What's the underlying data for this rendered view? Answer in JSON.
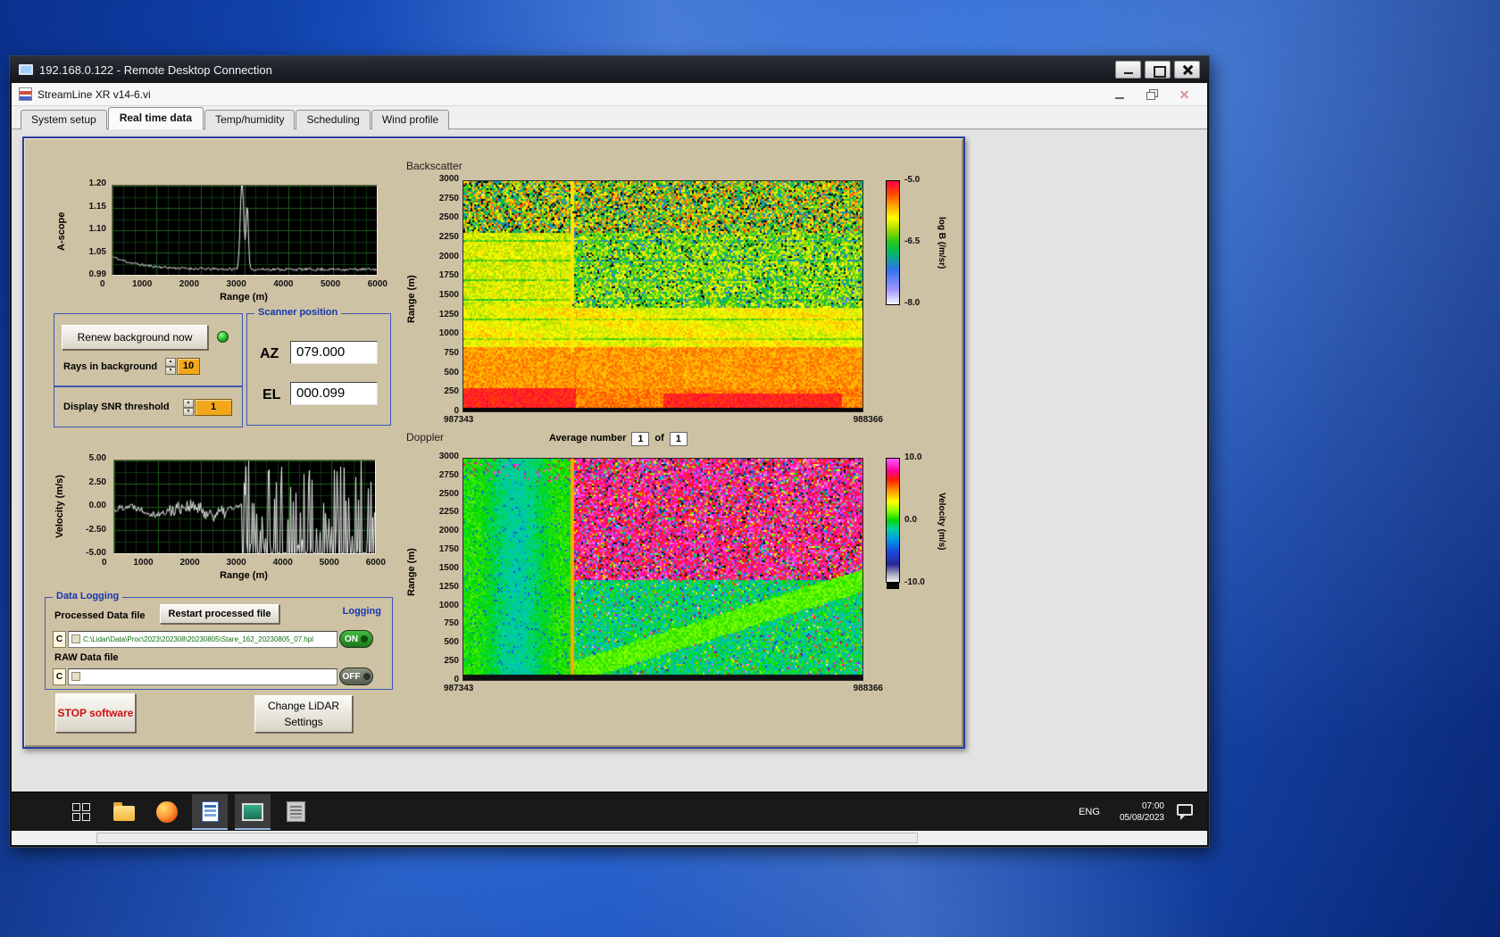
{
  "rdp": {
    "title": "192.168.0.122 - Remote Desktop Connection"
  },
  "app": {
    "title": "StreamLine XR v14-6.vi",
    "tabs": [
      "System setup",
      "Real time data",
      "Temp/humidity",
      "Scheduling",
      "Wind profile"
    ]
  },
  "ascope": {
    "ylabel": "A-scope",
    "xlabel": "Range (m)",
    "yticks": [
      "1.20",
      "1.15",
      "1.10",
      "1.05",
      "0.99"
    ],
    "xticks": [
      "0",
      "1000",
      "2000",
      "3000",
      "4000",
      "5000",
      "6000"
    ]
  },
  "controls": {
    "renew": "Renew background now",
    "rays_label": "Rays in background",
    "rays_value": "10",
    "snr_label": "Display SNR threshold",
    "snr_value": "1"
  },
  "scanner": {
    "title": "Scanner position",
    "az_label": "AZ",
    "az_value": "079.000",
    "el_label": "EL",
    "el_value": "000.099"
  },
  "backscatter": {
    "title": "Backscatter",
    "range_label": "Range (m)",
    "yticks": [
      "3000",
      "2750",
      "2500",
      "2250",
      "2000",
      "1750",
      "1500",
      "1250",
      "1000",
      "750",
      "500",
      "250",
      "0"
    ],
    "xticks": [
      "987343",
      "988366"
    ],
    "cb_ticks": [
      "-5.0",
      "-6.5",
      "-8.0"
    ],
    "cb_label": "log B (/m/sr)"
  },
  "doppler": {
    "title": "Doppler",
    "avg_label": "Average number",
    "avg_value": "1",
    "of_label": "of",
    "avg_count": "1",
    "range_label": "Range (m)",
    "yticks": [
      "3000",
      "2750",
      "2500",
      "2250",
      "2000",
      "1750",
      "1500",
      "1250",
      "1000",
      "750",
      "500",
      "250",
      "0"
    ],
    "xticks": [
      "987343",
      "988366"
    ],
    "cb_ticks": [
      "10.0",
      "0.0",
      "-10.0"
    ],
    "cb_label": "Velocity (m/s)"
  },
  "velocity": {
    "ylabel": "Velocity (m/s)",
    "xlabel": "Range (m)",
    "yticks": [
      "5.00",
      "2.50",
      "0.00",
      "-2.50",
      "-5.00"
    ],
    "xticks": [
      "0",
      "1000",
      "2000",
      "3000",
      "4000",
      "5000",
      "6000"
    ]
  },
  "logging": {
    "title": "Data Logging",
    "processed_label": "Processed Data file",
    "restart_button": "Restart processed file",
    "logging_label": "Logging",
    "drive": "C",
    "processed_path": "C:\\Lidar\\Data\\Proc\\2023\\202308\\20230805\\Stare_162_20230805_07.hpl",
    "on_label": "ON",
    "raw_label": "RAW Data file",
    "raw_path": "",
    "off_label": "OFF"
  },
  "buttons": {
    "stop": "STOP software",
    "change": "Change LiDAR Settings"
  },
  "taskbar": {
    "lang": "ENG",
    "time": "07:00",
    "date": "05/08/2023"
  }
}
